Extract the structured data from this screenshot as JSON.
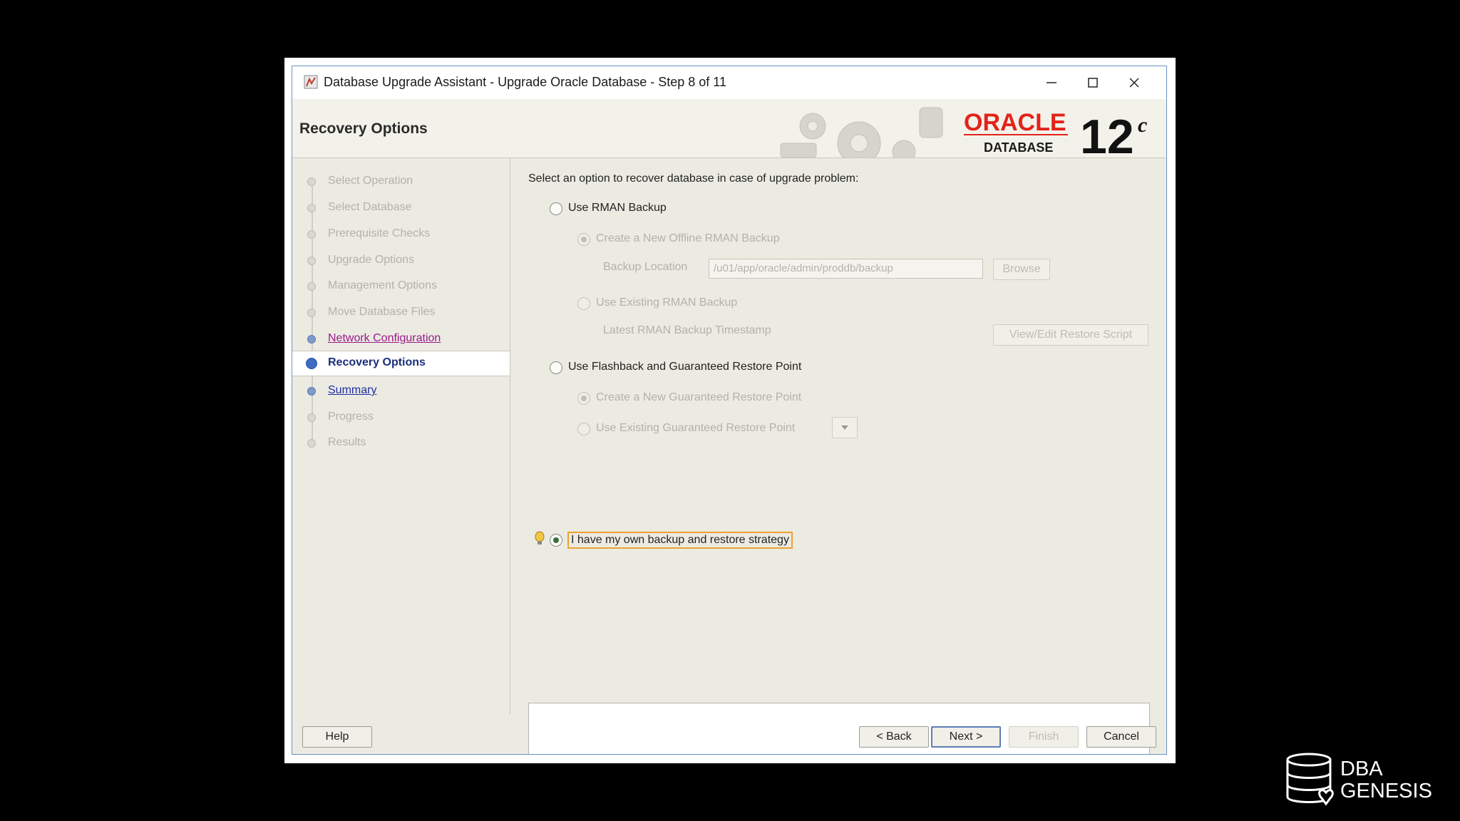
{
  "window": {
    "title": "Database Upgrade Assistant - Upgrade Oracle Database - Step 8 of 11",
    "page_title": "Recovery Options"
  },
  "logo": {
    "brand": "ORACLE",
    "sub": "DATABASE",
    "version": "12",
    "suffix": "c"
  },
  "steps": [
    {
      "label": "Select Operation",
      "state": "disabled"
    },
    {
      "label": "Select Database",
      "state": "disabled"
    },
    {
      "label": "Prerequisite Checks",
      "state": "disabled"
    },
    {
      "label": "Upgrade Options",
      "state": "disabled"
    },
    {
      "label": "Management Options",
      "state": "disabled"
    },
    {
      "label": "Move Database Files",
      "state": "disabled"
    },
    {
      "label": "Network Configuration",
      "state": "visited"
    },
    {
      "label": "Recovery Options",
      "state": "active"
    },
    {
      "label": "Summary",
      "state": "link"
    },
    {
      "label": "Progress",
      "state": "disabled"
    },
    {
      "label": "Results",
      "state": "disabled"
    }
  ],
  "content": {
    "intro": "Select an option to recover database in case of upgrade problem:",
    "rman": {
      "label": "Use RMAN Backup",
      "new_offline": "Create a New Offline RMAN Backup",
      "backup_location_label": "Backup Location",
      "backup_location_value": "/u01/app/oracle/admin/proddb/backup",
      "browse": "Browse",
      "use_existing": "Use Existing RMAN Backup",
      "timestamp_label": "Latest RMAN Backup Timestamp",
      "view_edit": "View/Edit Restore Script"
    },
    "flashback": {
      "label": "Use Flashback and Guaranteed Restore Point",
      "create_new": "Create a New Guaranteed Restore Point",
      "use_existing": "Use Existing Guaranteed Restore Point"
    },
    "own_strategy": "I have my own backup and restore strategy"
  },
  "buttons": {
    "help": "Help",
    "back": "< Back",
    "next": "Next >",
    "finish": "Finish",
    "cancel": "Cancel"
  },
  "watermark": {
    "line1": "DBA",
    "line2": "GENESIS"
  }
}
